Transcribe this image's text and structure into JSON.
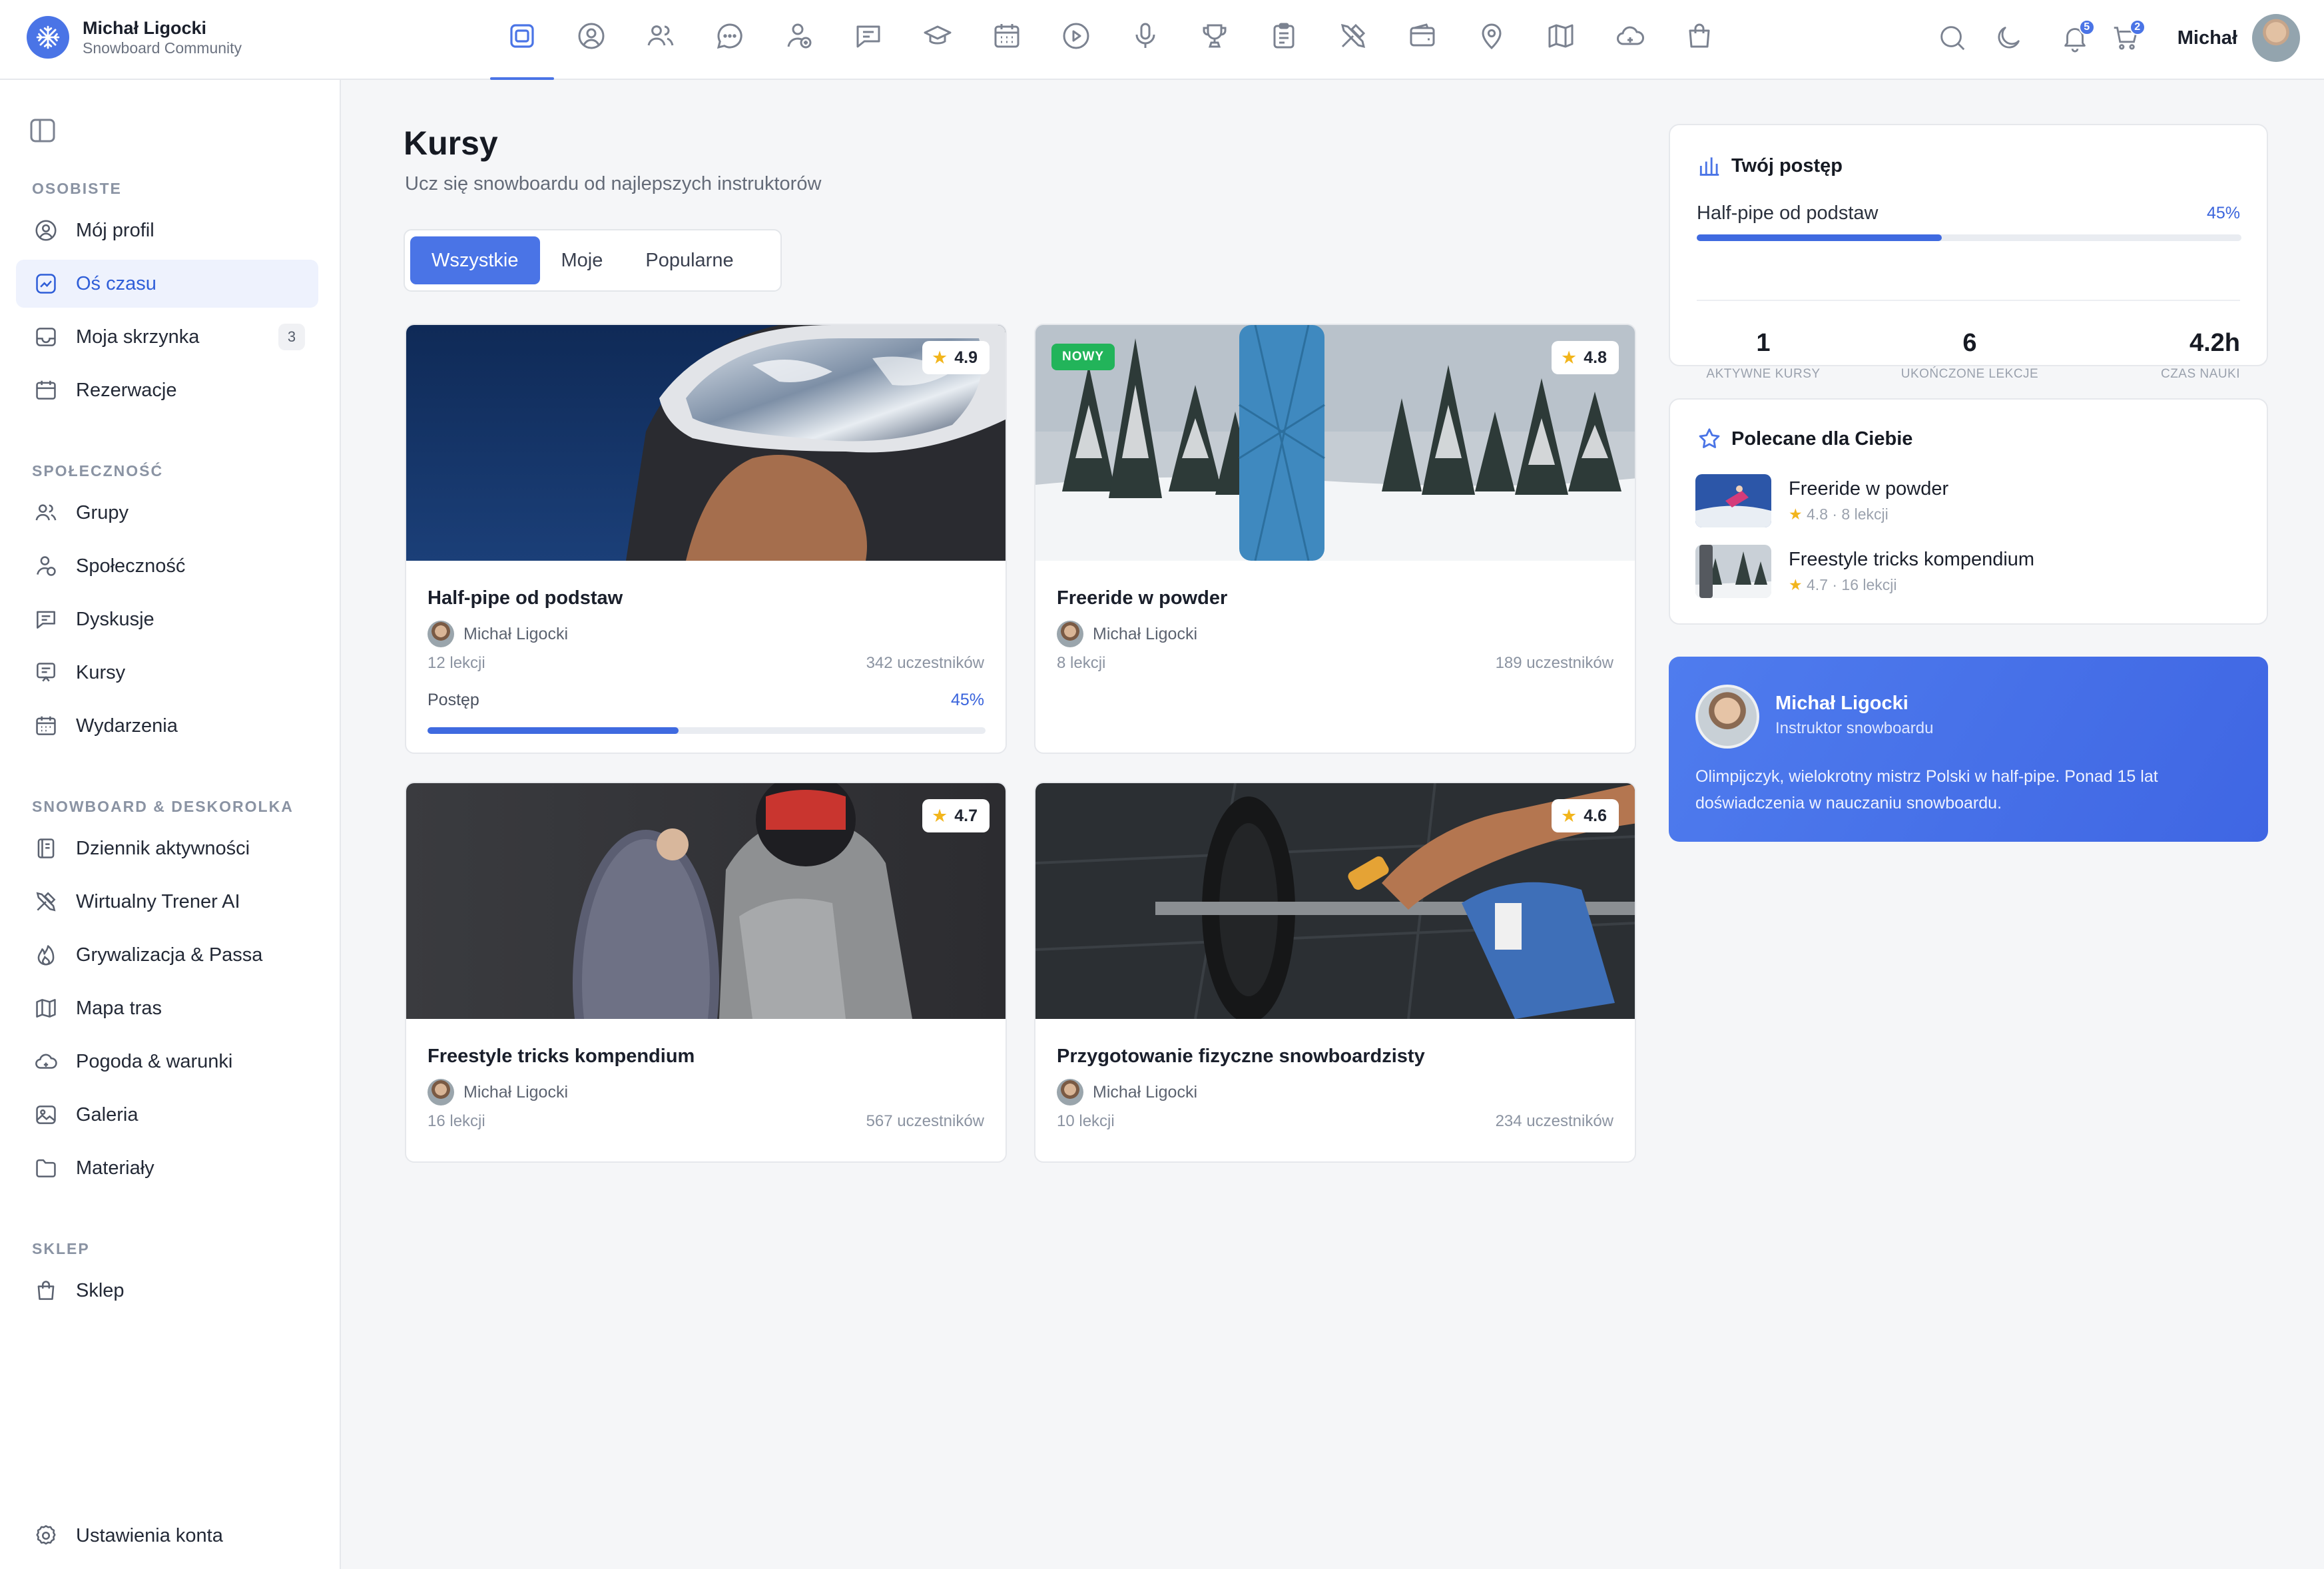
{
  "brand": {
    "name": "Michał Ligocki",
    "subtitle": "Snowboard Community",
    "logo_icon": "snowflake-icon"
  },
  "topnav": {
    "icons": [
      "courses-icon",
      "profile-icon",
      "groups-icon",
      "chat-icon",
      "community-icon",
      "discussion-icon",
      "graduation-cap-icon",
      "calendar-icon",
      "play-icon",
      "microphone-icon",
      "trophy-icon",
      "clipboard-icon",
      "tools-icon",
      "wallet-icon",
      "map-pin-icon",
      "map-icon",
      "weather-icon",
      "shop-bag-icon"
    ],
    "active_index": 0
  },
  "top_actions": {
    "notifications_count": "5",
    "cart_count": "2",
    "user_name": "Michał"
  },
  "sidebar": {
    "sections": [
      {
        "title": "OSOBISTE",
        "items": [
          {
            "label": "Mój profil",
            "icon": "user-circle-icon"
          },
          {
            "label": "Oś czasu",
            "icon": "timeline-icon",
            "active": true
          },
          {
            "label": "Moja skrzynka",
            "icon": "inbox-icon",
            "count": "3"
          },
          {
            "label": "Rezerwacje",
            "icon": "calendar-icon"
          }
        ]
      },
      {
        "title": "SPOŁECZNOŚĆ",
        "items": [
          {
            "label": "Grupy",
            "icon": "groups-icon"
          },
          {
            "label": "Społeczność",
            "icon": "community-icon"
          },
          {
            "label": "Dyskusje",
            "icon": "discussion-icon"
          },
          {
            "label": "Kursy",
            "icon": "courses-icon"
          },
          {
            "label": "Wydarzenia",
            "icon": "events-icon"
          }
        ]
      },
      {
        "title": "SNOWBOARD & DESKOROLKA",
        "items": [
          {
            "label": "Dziennik aktywności",
            "icon": "journal-icon"
          },
          {
            "label": "Wirtualny Trener AI",
            "icon": "ai-trainer-icon"
          },
          {
            "label": "Grywalizacja & Passa",
            "icon": "flame-icon"
          },
          {
            "label": "Mapa tras",
            "icon": "map-icon"
          },
          {
            "label": "Pogoda & warunki",
            "icon": "weather-icon"
          },
          {
            "label": "Galeria",
            "icon": "gallery-icon"
          },
          {
            "label": "Materiały",
            "icon": "folder-icon"
          }
        ]
      },
      {
        "title": "SKLEP",
        "items": [
          {
            "label": "Sklep",
            "icon": "shop-bag-icon"
          }
        ]
      }
    ],
    "settings_label": "Ustawienia konta"
  },
  "main": {
    "title": "Kursy",
    "subtitle": "Ucz się snowboardu od najlepszych instruktorów",
    "tabs": [
      "Wszystkie",
      "Moje",
      "Popularne"
    ],
    "courses": [
      {
        "title": "Half-pipe od podstaw",
        "author": "Michał Ligocki",
        "lessons": "12 lekcji",
        "participants": "342 uczestników",
        "rating": "4.9",
        "progress_label": "Postęp",
        "progress_text": "45%",
        "progress": 0.45
      },
      {
        "title": "Freeride w powder",
        "author": "Michał Ligocki",
        "lessons": "8 lekcji",
        "participants": "189 uczestników",
        "rating": "4.8",
        "badge": "NOWY"
      },
      {
        "title": "Freestyle tricks kompendium",
        "author": "Michał Ligocki",
        "lessons": "16 lekcji",
        "participants": "567 uczestników",
        "rating": "4.7"
      },
      {
        "title": "Przygotowanie fizyczne snowboardzisty",
        "author": "Michał Ligocki",
        "lessons": "10 lekcji",
        "participants": "234 uczestników",
        "rating": "4.6"
      }
    ]
  },
  "progress_panel": {
    "title": "Twój postęp",
    "course": "Half-pipe od podstaw",
    "percent_text": "45%",
    "progress": 0.45,
    "stats": [
      {
        "value": "1",
        "label": "AKTYWNE KURSY"
      },
      {
        "value": "6",
        "label": "UKOŃCZONE LEKCJE"
      },
      {
        "value": "4.2h",
        "label": "CZAS NAUKI"
      }
    ]
  },
  "recommended": {
    "title": "Polecane dla Ciebie",
    "items": [
      {
        "title": "Freeride w powder",
        "meta": "4.8 · 8 lekcji"
      },
      {
        "title": "Freestyle tricks kompendium",
        "meta": "4.7 · 16 lekcji"
      }
    ]
  },
  "instructor": {
    "name": "Michał Ligocki",
    "role": "Instruktor snowboardu",
    "bio": "Olimpijczyk, wielokrotny mistrz Polski w half-pipe. Ponad 15 lat doświadczenia w nauczaniu snowboardu."
  },
  "colors": {
    "accent": "#4a74e6",
    "star": "#f2b51c",
    "new_badge": "#22b45a"
  }
}
